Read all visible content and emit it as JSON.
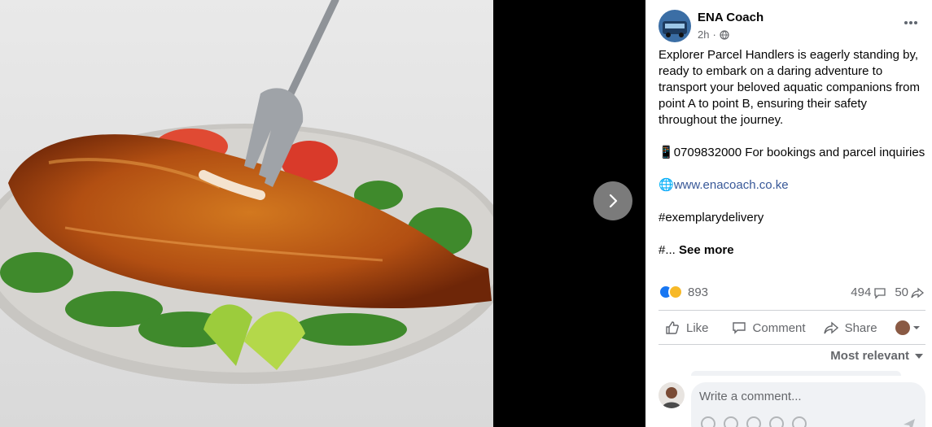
{
  "post": {
    "page_name": "ENA Coach",
    "time": "2h",
    "text_lines": [
      "Explorer Parcel Handlers is eagerly standing by, ready to embark on a daring adventure to transport your beloved aquatic companions from point A to point B, ensuring their safety throughout the journey."
    ],
    "phone_line": "0709832000 For bookings and parcel inquiries",
    "website": "www.enacoach.co.ke",
    "hashtag": "#exemplarydelivery",
    "truncated": "#...",
    "see_more": "See more"
  },
  "reactions": {
    "count": "893",
    "comments": "494",
    "shares": "50"
  },
  "actions": {
    "like": "Like",
    "comment": "Comment",
    "share": "Share"
  },
  "sort_label": "Most relevant",
  "composer": {
    "placeholder": "Write a comment..."
  },
  "colors": {
    "like_blue": "#1877f2",
    "haha_yellow": "#f7b928",
    "link": "#385898",
    "secondary_text": "#65676b"
  }
}
